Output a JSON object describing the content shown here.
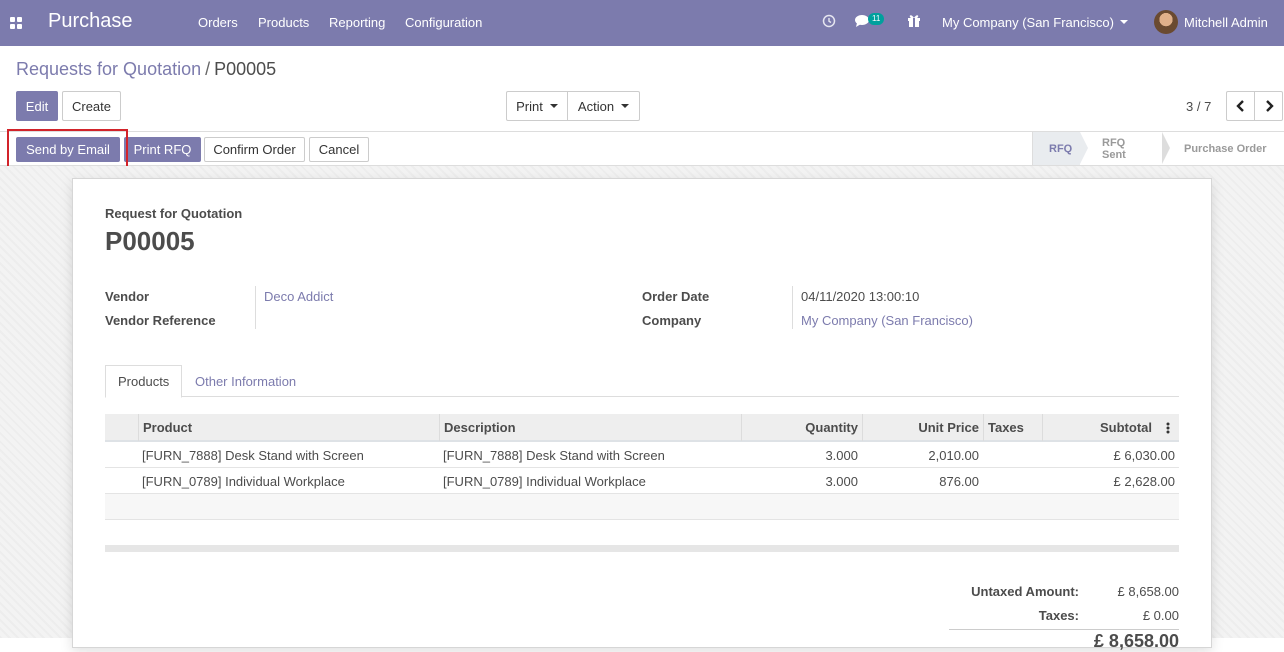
{
  "navbar": {
    "brand": "Purchase",
    "menu": [
      "Orders",
      "Products",
      "Reporting",
      "Configuration"
    ],
    "message_count": "11",
    "company": "My Company (San Francisco)",
    "user": "Mitchell Admin"
  },
  "breadcrumb": {
    "parent": "Requests for Quotation",
    "separator": "/",
    "current": "P00005"
  },
  "buttons": {
    "edit": "Edit",
    "create": "Create",
    "print": "Print",
    "action": "Action"
  },
  "pager": {
    "value": "3 / 7"
  },
  "statusbar": {
    "send_email": "Send by Email",
    "print_rfq": "Print RFQ",
    "confirm": "Confirm Order",
    "cancel": "Cancel",
    "stages": [
      "RFQ",
      "RFQ Sent",
      "Purchase Order"
    ],
    "active_stage": "RFQ"
  },
  "form": {
    "subtitle": "Request for Quotation",
    "name": "P00005",
    "vendor_label": "Vendor",
    "vendor_value": "Deco Addict",
    "vendor_ref_label": "Vendor Reference",
    "vendor_ref_value": "",
    "order_date_label": "Order Date",
    "order_date_value": "04/11/2020 13:00:10",
    "company_label": "Company",
    "company_value": "My Company (San Francisco)"
  },
  "tabs": [
    "Products",
    "Other Information"
  ],
  "table": {
    "headers": [
      "Product",
      "Description",
      "Quantity",
      "Unit Price",
      "Taxes",
      "Subtotal"
    ],
    "rows": [
      {
        "product": "[FURN_7888] Desk Stand with Screen",
        "description": "[FURN_7888] Desk Stand with Screen",
        "quantity": "3.000",
        "unit_price": "2,010.00",
        "taxes": "",
        "subtotal": "£ 6,030.00"
      },
      {
        "product": "[FURN_0789] Individual Workplace",
        "description": "[FURN_0789] Individual Workplace",
        "quantity": "3.000",
        "unit_price": "876.00",
        "taxes": "",
        "subtotal": "£ 2,628.00"
      }
    ]
  },
  "totals": {
    "untaxed_label": "Untaxed Amount:",
    "untaxed_value": "£ 8,658.00",
    "taxes_label": "Taxes:",
    "taxes_value": "£ 0.00",
    "total_value": "£ 8,658.00"
  },
  "colors": {
    "brand": "#7c7bad",
    "highlight": "#d2232a",
    "badge": "#00a09d"
  },
  "icons": {
    "apps": "apps-grid-icon",
    "clock": "clock-icon",
    "chat": "chat-icon",
    "gift": "gift-icon",
    "prev": "chevron-left-icon",
    "next": "chevron-right-icon",
    "column_options": "kebab-icon"
  }
}
